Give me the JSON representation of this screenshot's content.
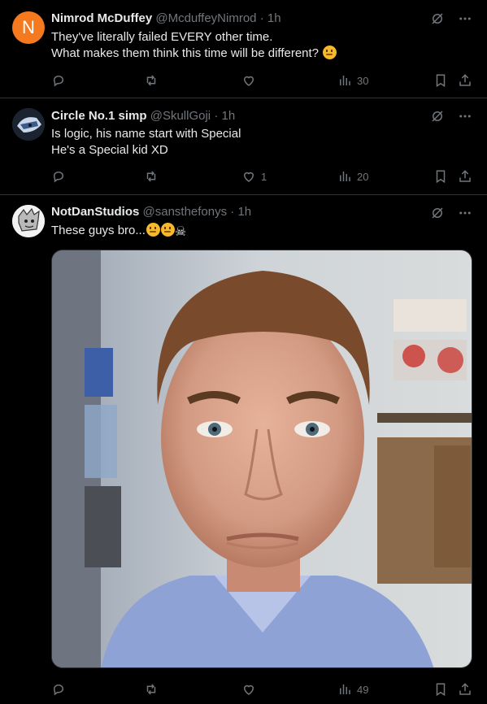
{
  "tweets": [
    {
      "avatar_letter": "N",
      "avatar_color": "#f4791f",
      "name": "Nimrod McDuffey",
      "handle": "@McduffeyNimrod",
      "time": "· 1h",
      "lines": [
        "They've literally failed EVERY other time.",
        "What makes them think this time will be different?"
      ],
      "views": "30"
    },
    {
      "name": "Circle No.1 simp",
      "handle": "@SkullGoji",
      "time": "· 1h",
      "lines": [
        "Is logic, his name start with Special",
        "He's a Special kid XD"
      ],
      "likes": "1",
      "views": "20"
    },
    {
      "name": "NotDanStudios",
      "handle": "@sansthefonys",
      "time": "· 1h",
      "text": "These guys bro...",
      "views": "49"
    }
  ]
}
